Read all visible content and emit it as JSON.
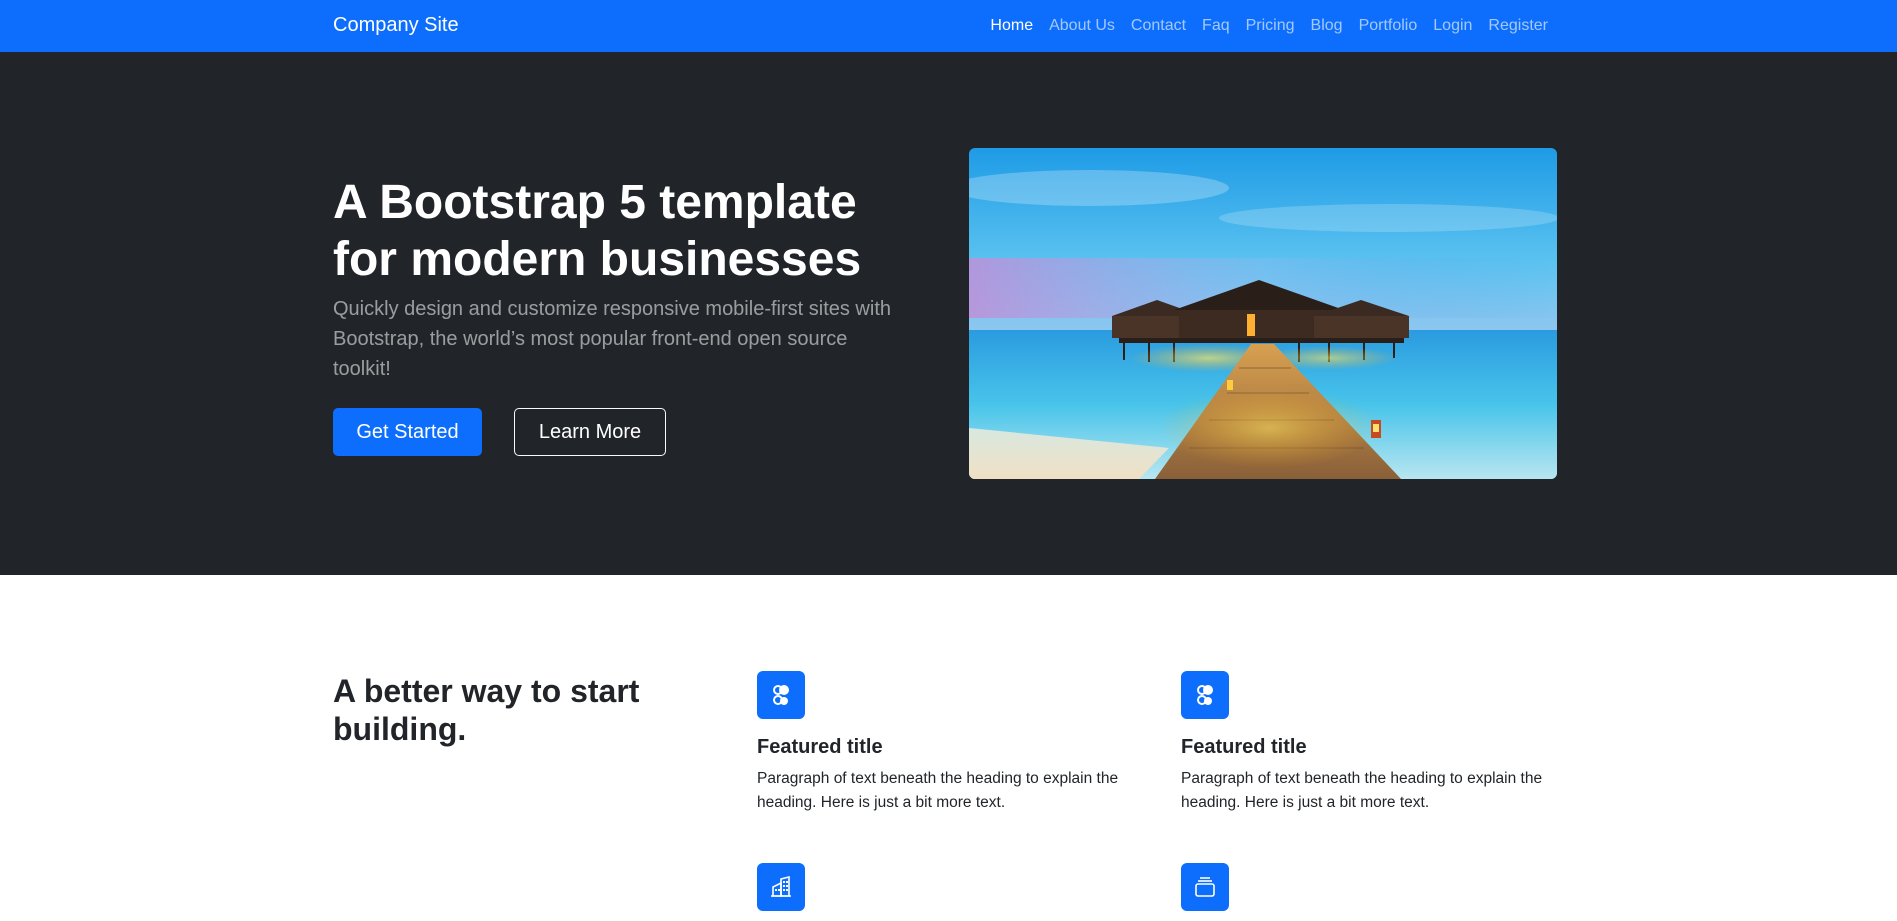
{
  "navbar": {
    "brand": "Company Site",
    "links": [
      "Home",
      "About Us",
      "Contact",
      "Faq",
      "Pricing",
      "Blog",
      "Portfolio",
      "Login",
      "Register"
    ]
  },
  "hero": {
    "title": "A Bootstrap 5 template for modern businesses",
    "lead": "Quickly design and customize responsive mobile-first sites with Bootstrap, the world’s most popular front-end open source toolkit!",
    "primary_button": "Get Started",
    "secondary_button": "Learn More",
    "image_description_icon": "beach-resort-image"
  },
  "features": {
    "heading": "A better way to start building.",
    "items": [
      {
        "icon": "collection-icon",
        "title": "Featured title",
        "text": "Paragraph of text beneath the heading to explain the heading. Here is just a bit more text."
      },
      {
        "icon": "collection-icon",
        "title": "Featured title",
        "text": "Paragraph of text beneath the heading to explain the heading. Here is just a bit more text."
      },
      {
        "icon": "building-icon",
        "title": "",
        "text": ""
      },
      {
        "icon": "toggles-icon",
        "title": "",
        "text": ""
      }
    ]
  },
  "colors": {
    "primary": "#0d6efd",
    "dark": "#212529",
    "white": "#ffffff"
  }
}
